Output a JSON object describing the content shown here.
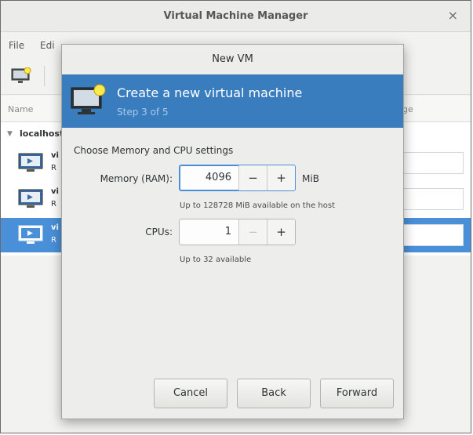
{
  "window": {
    "title": "Virtual Machine Manager",
    "close_glyph": "×"
  },
  "menubar": {
    "items": [
      "File",
      "Edi"
    ]
  },
  "toolbar": {
    "new_vm_icon": "monitor-new-icon"
  },
  "columns": {
    "name": "Name",
    "usage": "ge"
  },
  "vm_list": {
    "host": "localhost",
    "vms": [
      {
        "name": "vi",
        "state": "R",
        "selected": false
      },
      {
        "name": "vi",
        "state": "R",
        "selected": false
      },
      {
        "name": "vi",
        "state": "R",
        "selected": true
      }
    ]
  },
  "dialog": {
    "title": "New VM",
    "banner": {
      "title": "Create a new virtual machine",
      "step": "Step 3 of 5",
      "icon": "monitor-new-icon"
    },
    "section_label": "Choose Memory and CPU settings",
    "memory": {
      "label": "Memory (RAM):",
      "value": "4096",
      "unit": "MiB",
      "minus": "−",
      "plus": "+",
      "hint": "Up to 128728 MiB available on the host"
    },
    "cpus": {
      "label": "CPUs:",
      "value": "1",
      "minus": "−",
      "plus": "+",
      "hint": "Up to 32 available"
    },
    "buttons": {
      "cancel": "Cancel",
      "back": "Back",
      "forward": "Forward"
    }
  },
  "colors": {
    "banner": "#3a7dbf",
    "selection": "#4a90d9",
    "focus": "#4a90d9"
  }
}
